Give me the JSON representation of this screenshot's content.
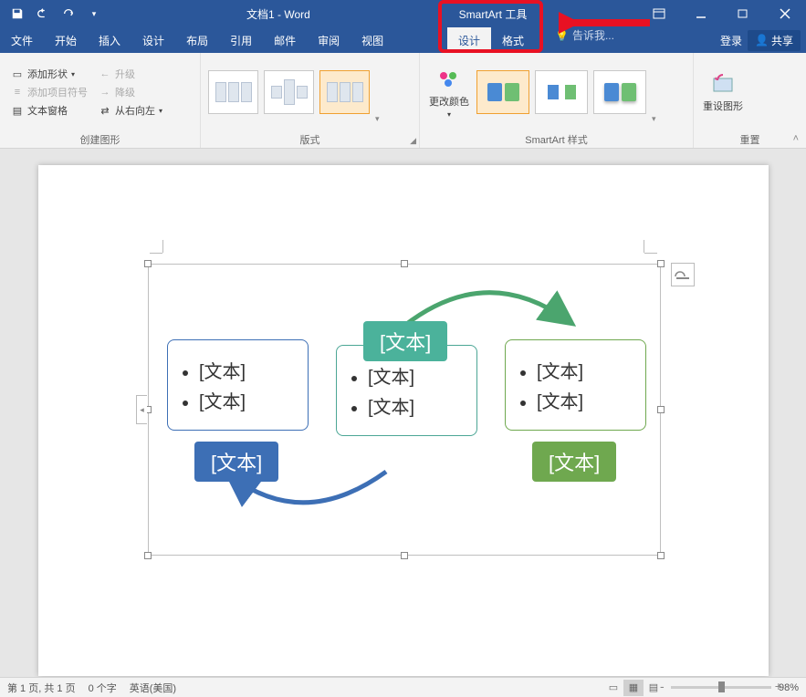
{
  "title": {
    "doc": "文档1 - Word",
    "context_tool": "SmartArt 工具"
  },
  "menu": {
    "items": [
      "文件",
      "开始",
      "插入",
      "设计",
      "布局",
      "引用",
      "邮件",
      "审阅",
      "视图"
    ],
    "context": [
      "设计",
      "格式"
    ],
    "tell_me": "告诉我...",
    "login": "登录",
    "share": "共享"
  },
  "ribbon": {
    "group1": {
      "label": "创建图形",
      "add_shape": "添加形状",
      "add_bullet": "添加项目符号",
      "text_pane": "文本窗格",
      "promote": "升级",
      "demote": "降级",
      "rtl": "从右向左"
    },
    "group2": {
      "label": "版式"
    },
    "group3": {
      "label": "SmartArt 样式",
      "change_colors": "更改颜色"
    },
    "group4": {
      "label": "重置",
      "reset": "重设图形"
    }
  },
  "smartart": {
    "placeholder": "[文本]"
  },
  "status": {
    "page": "第 1 页, 共 1 页",
    "words": "0 个字",
    "lang": "英语(美国)",
    "zoom": "98%"
  }
}
